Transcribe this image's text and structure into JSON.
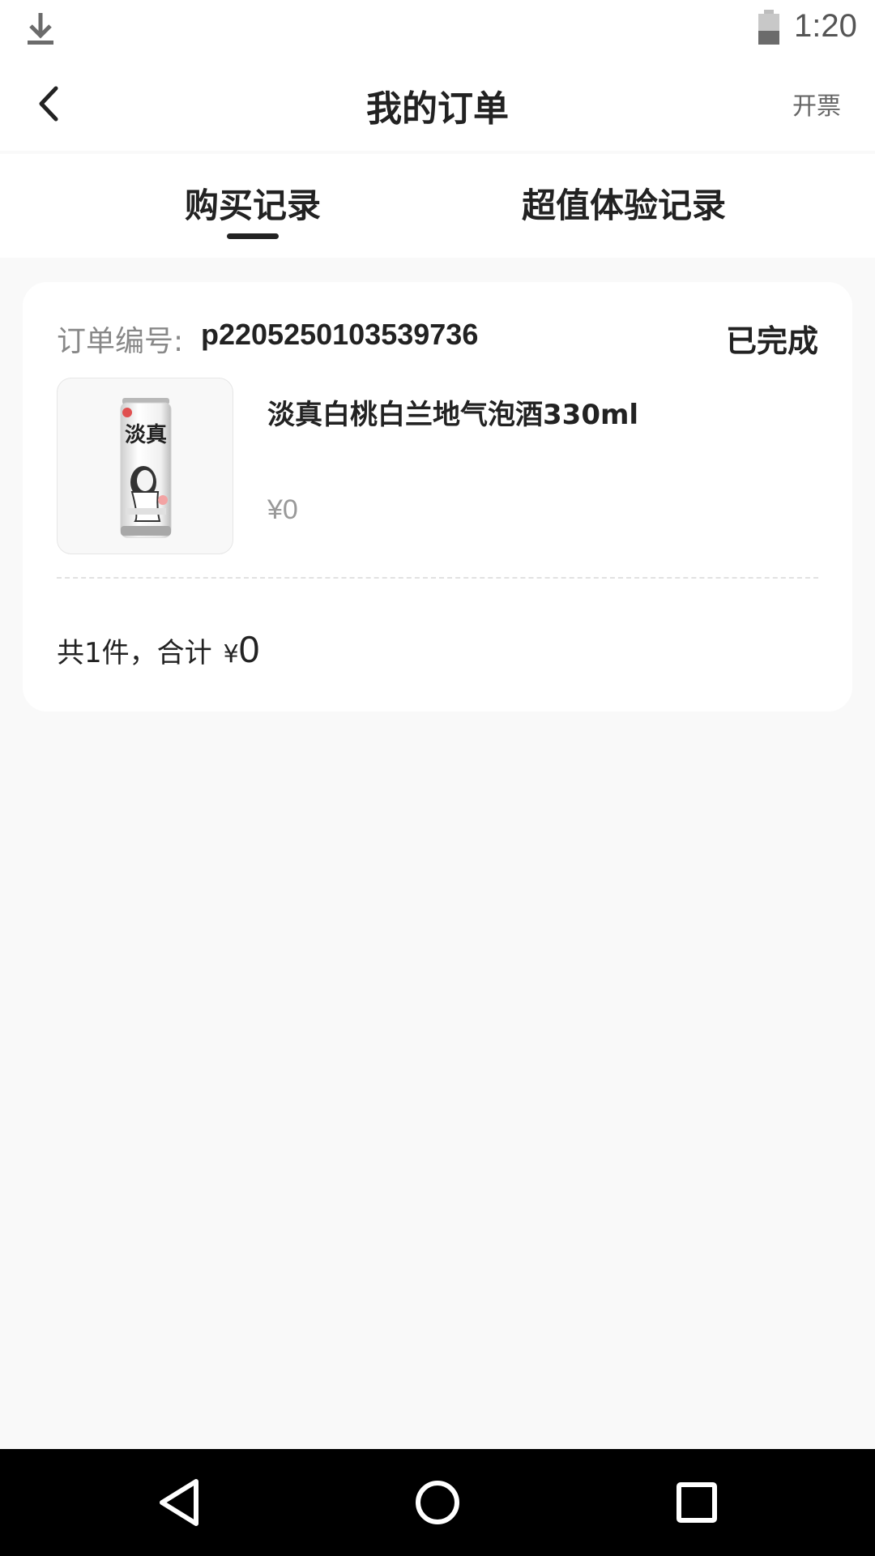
{
  "status_bar": {
    "time": "1:20",
    "icons": [
      "download-icon",
      "battery-icon"
    ]
  },
  "header": {
    "title": "我的订单",
    "back_icon": "chevron-left-icon",
    "invoice_label": "开票"
  },
  "tabs": [
    {
      "label": "购买记录",
      "active": true
    },
    {
      "label": "超值体验记录",
      "active": false
    }
  ],
  "order": {
    "number_label": "订单编号:",
    "number": "p2205250103539736",
    "status": "已完成",
    "product": {
      "name": "淡真白桃白兰地气泡酒330ml",
      "price": "¥0",
      "can_text": "淡真"
    },
    "summary_text": "共1件，合计",
    "summary_currency": "¥",
    "summary_amount": "0"
  },
  "colors": {
    "background": "#f9f9f9",
    "card": "#ffffff",
    "text": "#222222",
    "muted": "#888888",
    "nav_bar": "#000000"
  },
  "nav_bar": {
    "icons": [
      "triangle-back-icon",
      "circle-home-icon",
      "square-recents-icon"
    ]
  }
}
